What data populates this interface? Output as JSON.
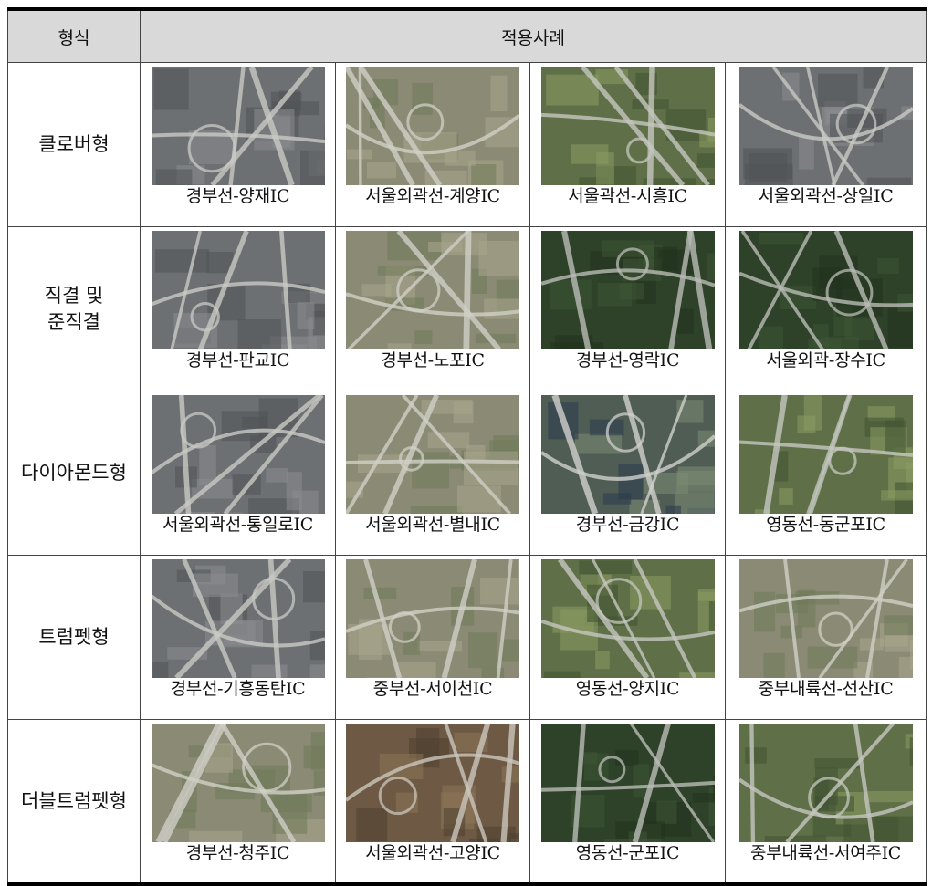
{
  "header": {
    "type_col": "형식",
    "cases_col": "적용사례"
  },
  "rows": [
    {
      "type": "클로버형",
      "cases": [
        {
          "label": "경부선-양재IC",
          "tone": "urban"
        },
        {
          "label": "서울외곽선-계양IC",
          "tone": "field"
        },
        {
          "label": "서울곽선-시흥IC",
          "tone": "green"
        },
        {
          "label": "서울외곽선-상일IC",
          "tone": "urban"
        }
      ]
    },
    {
      "type": "직결 및 준직결",
      "cases": [
        {
          "label": "경부선-판교IC",
          "tone": "urban"
        },
        {
          "label": "경부선-노포IC",
          "tone": "field"
        },
        {
          "label": "경부선-영락IC",
          "tone": "forest"
        },
        {
          "label": "서울외곽-장수IC",
          "tone": "forest"
        }
      ]
    },
    {
      "type": "다이아몬드형",
      "cases": [
        {
          "label": "서울외곽선-통일로IC",
          "tone": "urban"
        },
        {
          "label": "서울외곽선-별내IC",
          "tone": "field"
        },
        {
          "label": "경부선-금강IC",
          "tone": "water"
        },
        {
          "label": "영동선-동군포IC",
          "tone": "green"
        }
      ]
    },
    {
      "type": "트럼펫형",
      "cases": [
        {
          "label": "경부선-기흥동탄IC",
          "tone": "urban"
        },
        {
          "label": "중부선-서이천IC",
          "tone": "field"
        },
        {
          "label": "영동선-양지IC",
          "tone": "green"
        },
        {
          "label": "중부내륙선-선산IC",
          "tone": "field"
        }
      ]
    },
    {
      "type": "더블트럼펫형",
      "cases": [
        {
          "label": "경부선-청주IC",
          "tone": "field"
        },
        {
          "label": "서울외곽선-고양IC",
          "tone": "brown"
        },
        {
          "label": "영동선-군포IC",
          "tone": "forest"
        },
        {
          "label": "중부내륙선-서여주IC",
          "tone": "green"
        }
      ]
    }
  ]
}
